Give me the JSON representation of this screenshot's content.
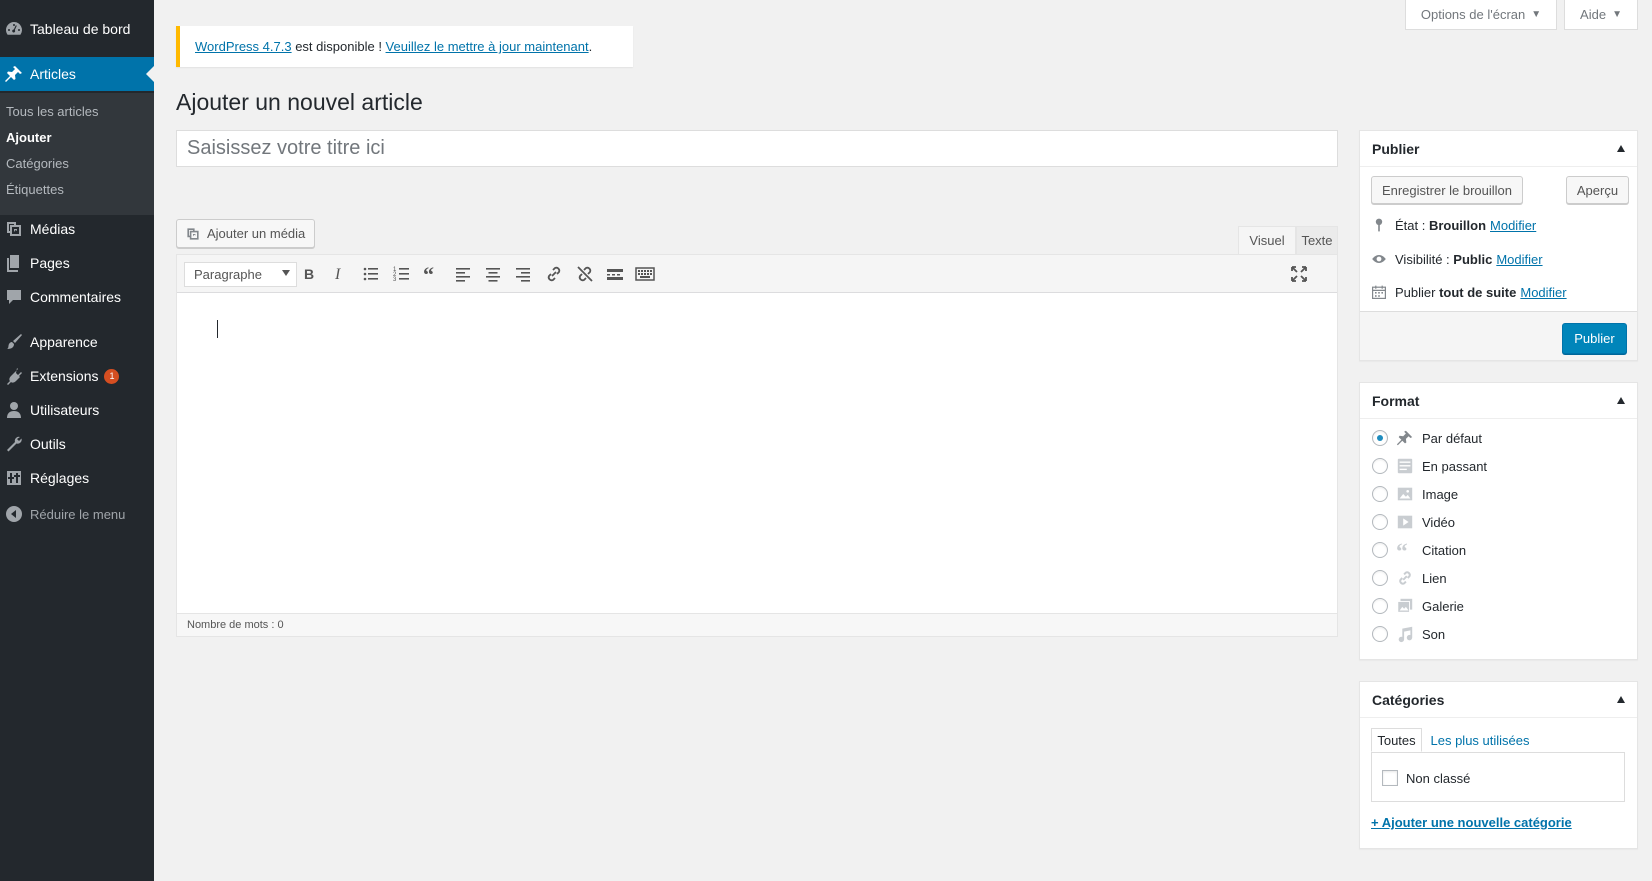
{
  "sidebar": {
    "dashboard": "Tableau de bord",
    "posts": "Articles",
    "submenu": [
      "Tous les articles",
      "Ajouter",
      "Catégories",
      "Étiquettes"
    ],
    "media": "Médias",
    "pages": "Pages",
    "comments": "Commentaires",
    "appearance": "Apparence",
    "plugins": "Extensions",
    "plugins_badge": "1",
    "users": "Utilisateurs",
    "tools": "Outils",
    "settings": "Réglages",
    "collapse": "Réduire le menu",
    "active_color": "#0073aa",
    "bg_color": "#23282d"
  },
  "screen_meta": {
    "screen_options": "Options de l'écran",
    "help": "Aide"
  },
  "notice": {
    "version_link": "WordPress 4.7.3",
    "text": " est disponible ! ",
    "update_link": "Veuillez le mettre à jour maintenant",
    "end": "."
  },
  "page_title": "Ajouter un nouvel article",
  "title_placeholder": "Saisissez votre titre ici",
  "editor": {
    "add_media": "Ajouter un média",
    "tab_visual": "Visuel",
    "tab_text": "Texte",
    "format_select": "Paragraphe",
    "word_count": "Nombre de mots : 0",
    "toolbar_icons": [
      "bold-icon",
      "italic-icon",
      "bullet-list-icon",
      "numbered-list-icon",
      "blockquote-icon",
      "align-left-icon",
      "align-center-icon",
      "align-right-icon",
      "link-icon",
      "unlink-icon",
      "read-more-icon",
      "toolbar-toggle-icon",
      "fullscreen-icon"
    ]
  },
  "publish": {
    "title": "Publier",
    "save_draft": "Enregistrer le brouillon",
    "preview": "Aperçu",
    "status_label": "État : ",
    "status_value": "Brouillon",
    "visibility_label": "Visibilité : ",
    "visibility_value": "Public",
    "schedule_label": "Publier ",
    "schedule_value": "tout de suite",
    "edit_link": "Modifier",
    "publish_button": "Publier",
    "primary_color": "#0085ba"
  },
  "format": {
    "title": "Format",
    "options": [
      "Par défaut",
      "En passant",
      "Image",
      "Vidéo",
      "Citation",
      "Lien",
      "Galerie",
      "Son"
    ],
    "selected": "Par défaut"
  },
  "categories": {
    "title": "Catégories",
    "tab_all": "Toutes",
    "tab_popular": "Les plus utilisées",
    "items": [
      "Non classé"
    ],
    "add_new": "+ Ajouter une nouvelle catégorie"
  }
}
